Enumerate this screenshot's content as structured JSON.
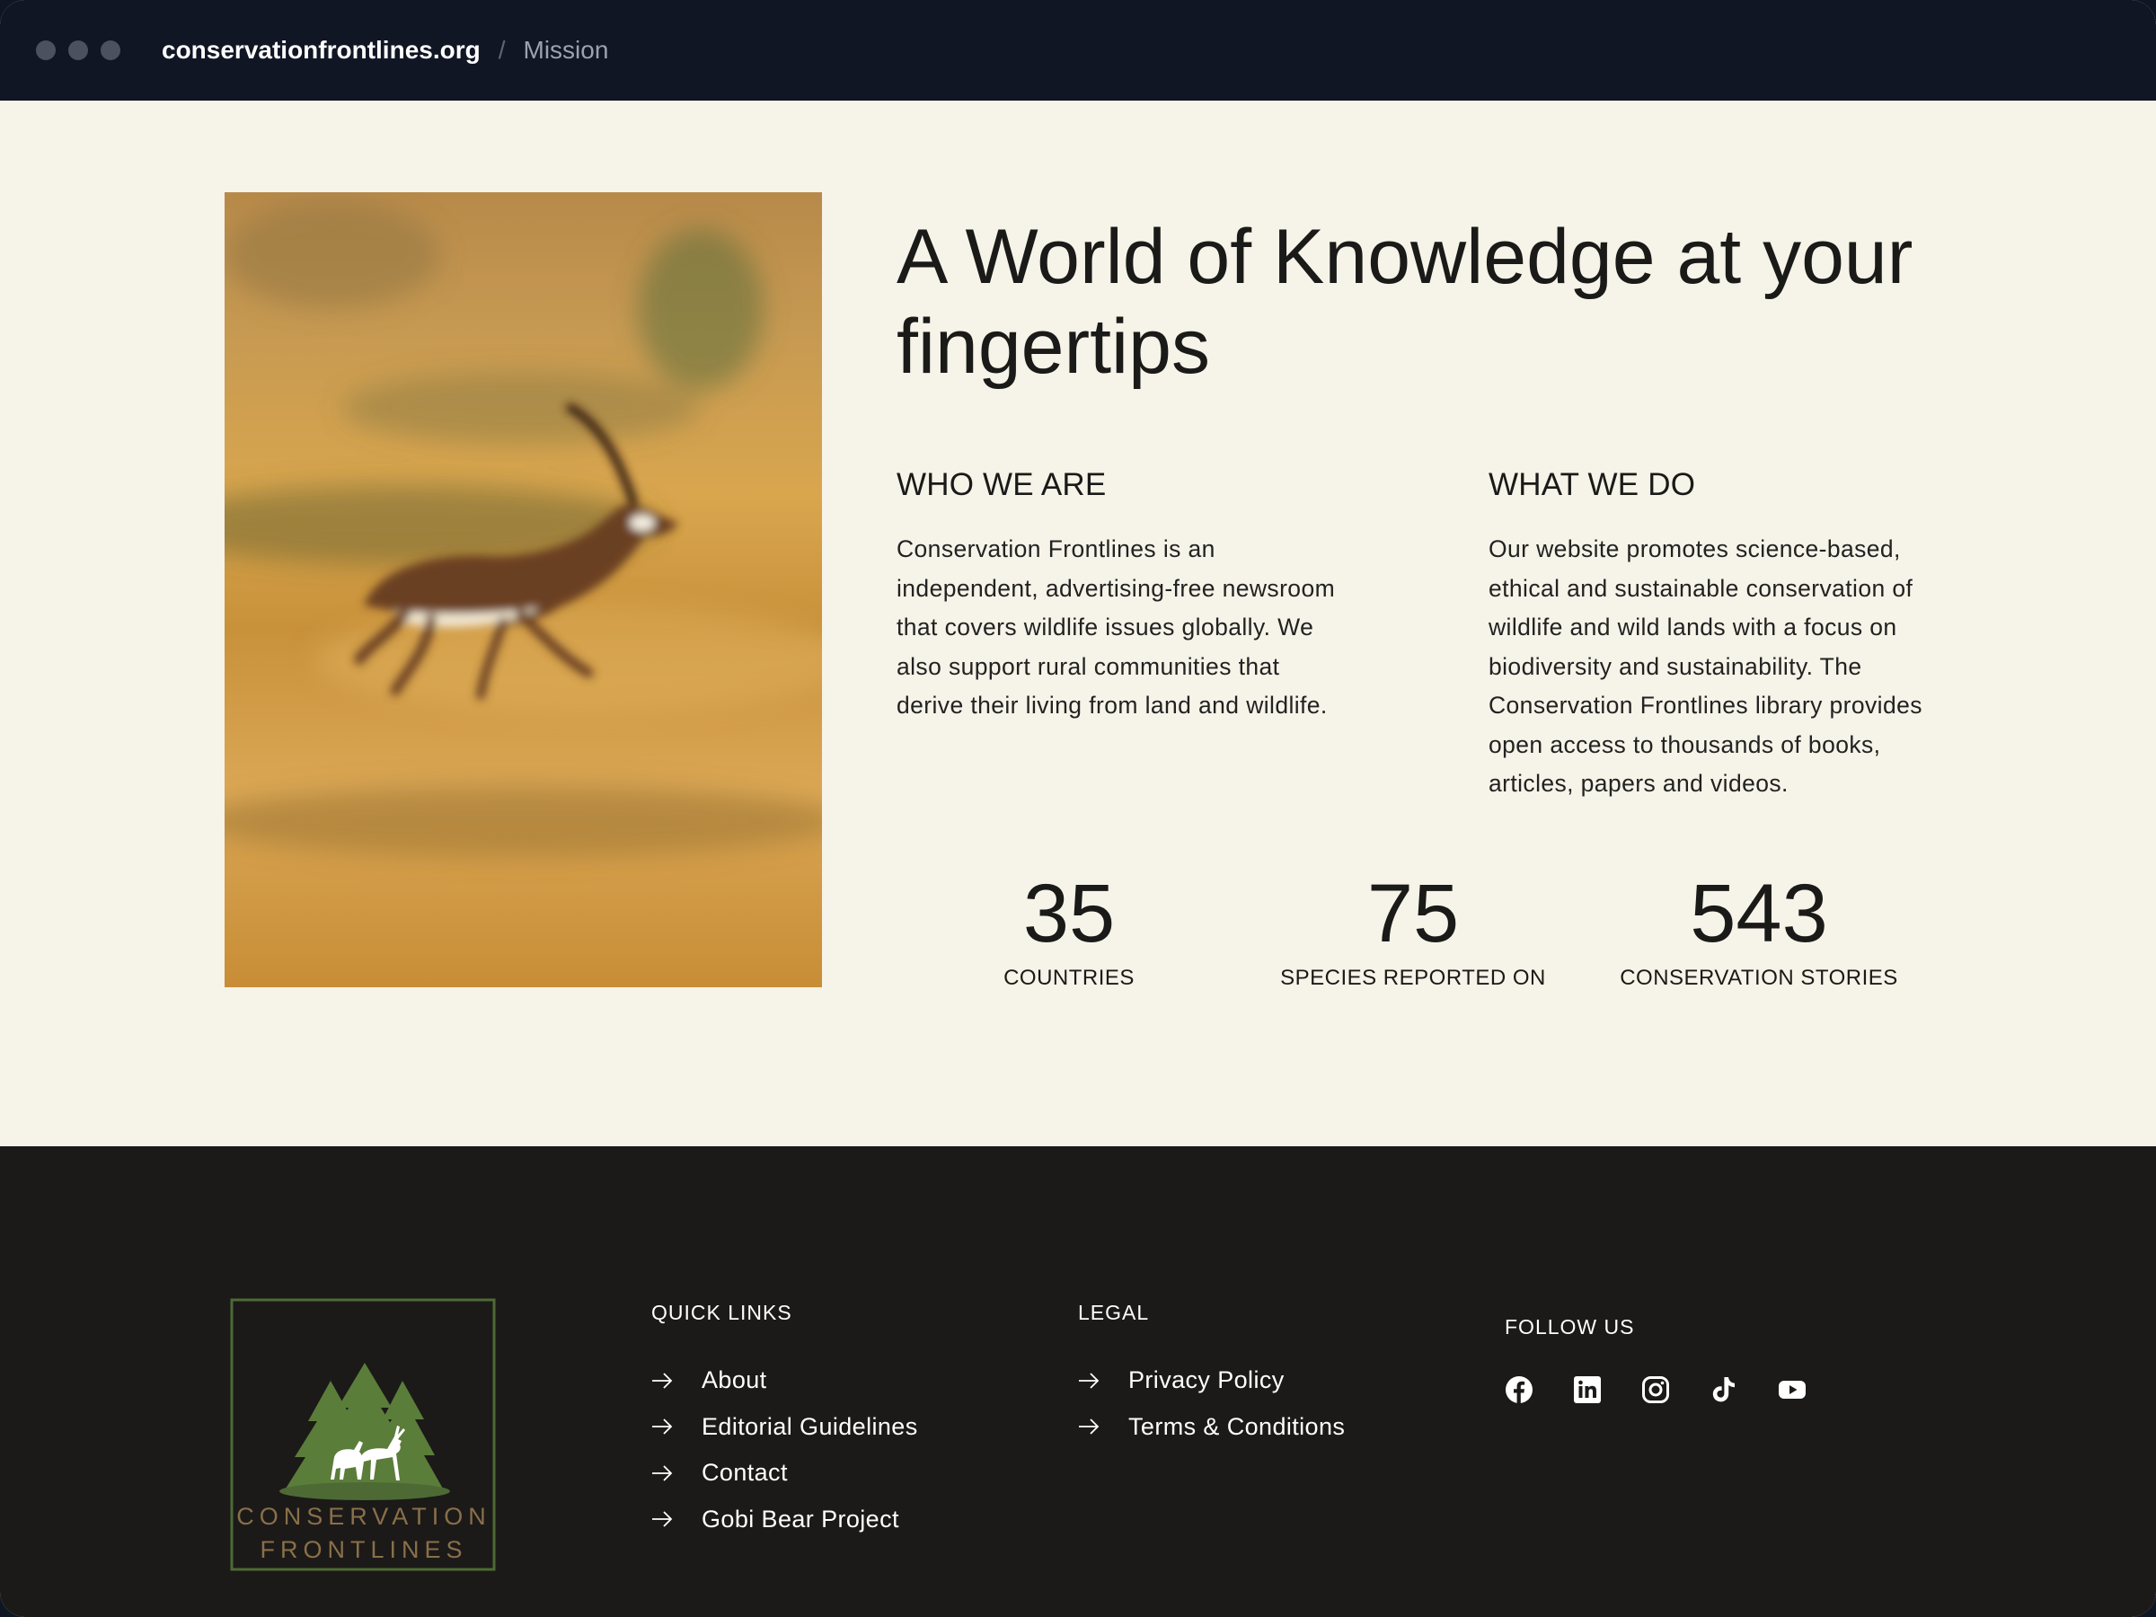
{
  "browser": {
    "domain": "conservationfrontlines.org",
    "separator": "/",
    "breadcrumb": "Mission"
  },
  "hero": {
    "image_alt": "Blackbuck antelope running through golden grassland",
    "headline": "A World of Knowledge at your fingertips"
  },
  "who_we_are": {
    "title": "WHO WE ARE",
    "body": "Conservation Frontlines is an independent, advertising-free newsroom that covers wildlife issues globally. We also support rural communities that derive their living from land and wildlife."
  },
  "what_we_do": {
    "title": "WHAT WE DO",
    "body": "Our website promotes science-based, ethical and sustainable conservation of wildlife and wild lands with a focus on biodiversity and sustainability. The Conservation Frontlines library provides open access to thousands of books, articles, papers and videos."
  },
  "stats": [
    {
      "value": "35",
      "label": "COUNTRIES"
    },
    {
      "value": "75",
      "label": "SPECIES REPORTED ON"
    },
    {
      "value": "543",
      "label": "CONSERVATION STORIES"
    }
  ],
  "footer": {
    "logo": {
      "line1": "CONSERVATION",
      "line2": "FRONTLINES"
    },
    "quick_links": {
      "title": "QUICK LINKS",
      "items": [
        "About",
        "Editorial Guidelines",
        "Contact",
        "Gobi Bear Project"
      ]
    },
    "legal": {
      "title": "LEGAL",
      "items": [
        "Privacy Policy",
        "Terms & Conditions"
      ]
    },
    "follow": {
      "title": "FOLLOW US",
      "icons": [
        "facebook-icon",
        "linkedin-icon",
        "instagram-icon",
        "tiktok-icon",
        "youtube-icon"
      ]
    }
  },
  "colors": {
    "topbar": "#101624",
    "page_background": "#f6f3e8",
    "footer_background": "#1b1a18",
    "logo_green": "#5b7d3a",
    "logo_text": "#8a6f4a"
  }
}
